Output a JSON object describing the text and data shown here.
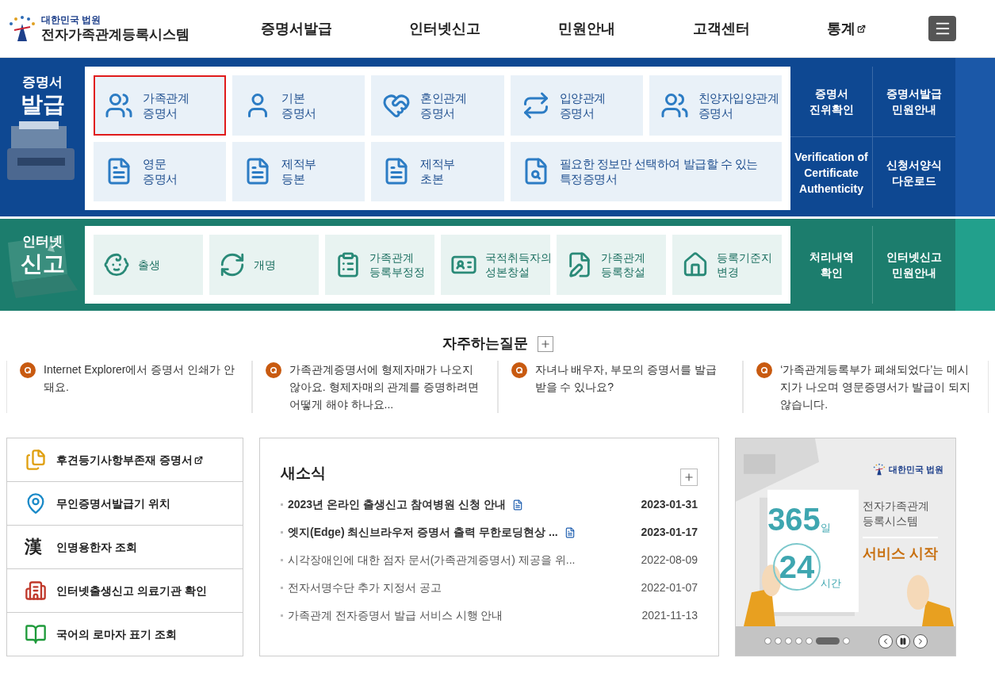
{
  "header": {
    "logo_top": "대한민국 법원",
    "logo_title": "전자가족관계등록시스템",
    "nav": [
      {
        "label": "증명서발급",
        "external": false
      },
      {
        "label": "인터넷신고",
        "external": false
      },
      {
        "label": "민원안내",
        "external": false
      },
      {
        "label": "고객센터",
        "external": false
      },
      {
        "label": "통계",
        "external": true
      }
    ]
  },
  "certificate": {
    "title_top": "증명서",
    "title_main": "발급",
    "tiles": [
      {
        "label": "가족관계\n증명서",
        "selected": true,
        "wide": false
      },
      {
        "label": "기본\n증명서",
        "selected": false,
        "wide": false
      },
      {
        "label": "혼인관계\n증명서",
        "selected": false,
        "wide": false
      },
      {
        "label": "입양관계\n증명서",
        "selected": false,
        "wide": false
      },
      {
        "label": "친양자입양관계\n증명서",
        "selected": false,
        "wide": false
      },
      {
        "label": "영문\n증명서",
        "selected": false,
        "wide": false
      },
      {
        "label": "제적부\n등본",
        "selected": false,
        "wide": false
      },
      {
        "label": "제적부\n초본",
        "selected": false,
        "wide": false
      },
      {
        "label": "필요한 정보만 선택하여 발급할 수 있는\n특정증명서",
        "selected": false,
        "wide": true
      }
    ],
    "links": [
      "증명서\n진위확인",
      "증명서발급\n민원안내",
      "Verification of\nCertificate\nAuthenticity",
      "신청서양식\n다운로드"
    ]
  },
  "report": {
    "title_top": "인터넷",
    "title_main": "신고",
    "tiles": [
      {
        "label": "출생"
      },
      {
        "label": "개명"
      },
      {
        "label": "가족관계\n등록부정정"
      },
      {
        "label": "국적취득자의\n성본창설"
      },
      {
        "label": "가족관계\n등록창설"
      },
      {
        "label": "등록기준지\n변경"
      }
    ],
    "links": [
      "처리내역\n확인",
      "인터넷신고\n민원안내"
    ]
  },
  "faq": {
    "title": "자주하는질문",
    "items": [
      "Internet Explorer에서 증명서 인쇄가 안돼요.",
      "가족관계증명서에 형제자매가 나오지 않아요. 형제자매의 관계를 증명하려면 어떻게 해야 하나요...",
      "자녀나 배우자, 부모의 증명서를 발급 받을 수 있나요?",
      "‘가족관계등록부가 폐쇄되었다’는 메시지가 나오며 영문증명서가 발급이 되지 않습니다."
    ]
  },
  "quick_links": [
    {
      "label": "후견등기사항부존재 증명서",
      "external": true
    },
    {
      "label": "무인증명서발급기 위치",
      "external": false
    },
    {
      "label": "인명용한자 조회",
      "external": false
    },
    {
      "label": "인터넷출생신고 의료기관 확인",
      "external": false
    },
    {
      "label": "국어의 로마자 표기 조회",
      "external": false
    }
  ],
  "hanja_glyph": "漢",
  "news": {
    "title": "새소식",
    "items": [
      {
        "title": "2023년 온라인 출생신고 참여병원 신청 안내",
        "date": "2023-01-31",
        "new": true
      },
      {
        "title": "엣지(Edge) 최신브라우저 증명서 출력 무한로딩현상 ...",
        "date": "2023-01-17",
        "new": true
      },
      {
        "title": "시각장애인에 대한 점자 문서(가족관계증명서) 제공을 위...",
        "date": "2022-08-09",
        "new": false
      },
      {
        "title": "전자서명수단 추가 지정서 공고",
        "date": "2022-01-07",
        "new": false
      },
      {
        "title": "가족관계 전자증명서 발급 서비스 시행 안내",
        "date": "2021-11-13",
        "new": false
      }
    ]
  },
  "banner": {
    "logo": "대한민국 법원",
    "days": "365",
    "days_unit": "일",
    "hours": "24",
    "hours_unit": "시간",
    "system": "전자가족관계\n등록시스템",
    "headline": "서비스 시작",
    "dots": [
      {
        "selected": false
      },
      {
        "selected": false
      },
      {
        "selected": false
      },
      {
        "selected": false
      },
      {
        "selected": false
      },
      {
        "selected": true
      },
      {
        "selected": false
      }
    ],
    "paused": false
  }
}
